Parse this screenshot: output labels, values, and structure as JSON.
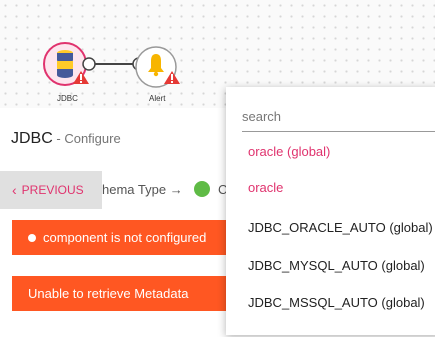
{
  "canvas": {
    "nodes": [
      {
        "label": "JDBC",
        "icon": "database-icon"
      },
      {
        "label": "Alert",
        "icon": "bell-icon"
      }
    ]
  },
  "panel": {
    "title": "JDBC",
    "subtitle": " - Configure",
    "previous_label": "PREVIOUS",
    "step_text": "hema Type →",
    "step_trailing": "C"
  },
  "banners": {
    "not_configured": "component is not configured",
    "metadata": "Unable to retrieve Metadata"
  },
  "dropdown": {
    "placeholder": "search",
    "options": [
      "oracle (global)",
      "oracle",
      "JDBC_ORACLE_AUTO (global)",
      "JDBC_MYSQL_AUTO (global)",
      "JDBC_MSSQL_AUTO (global)"
    ]
  },
  "colors": {
    "accent_pink": "#e0336e",
    "banner_orange": "#ff5722",
    "status_green": "#5fbb46",
    "warning_red": "#e53935"
  }
}
